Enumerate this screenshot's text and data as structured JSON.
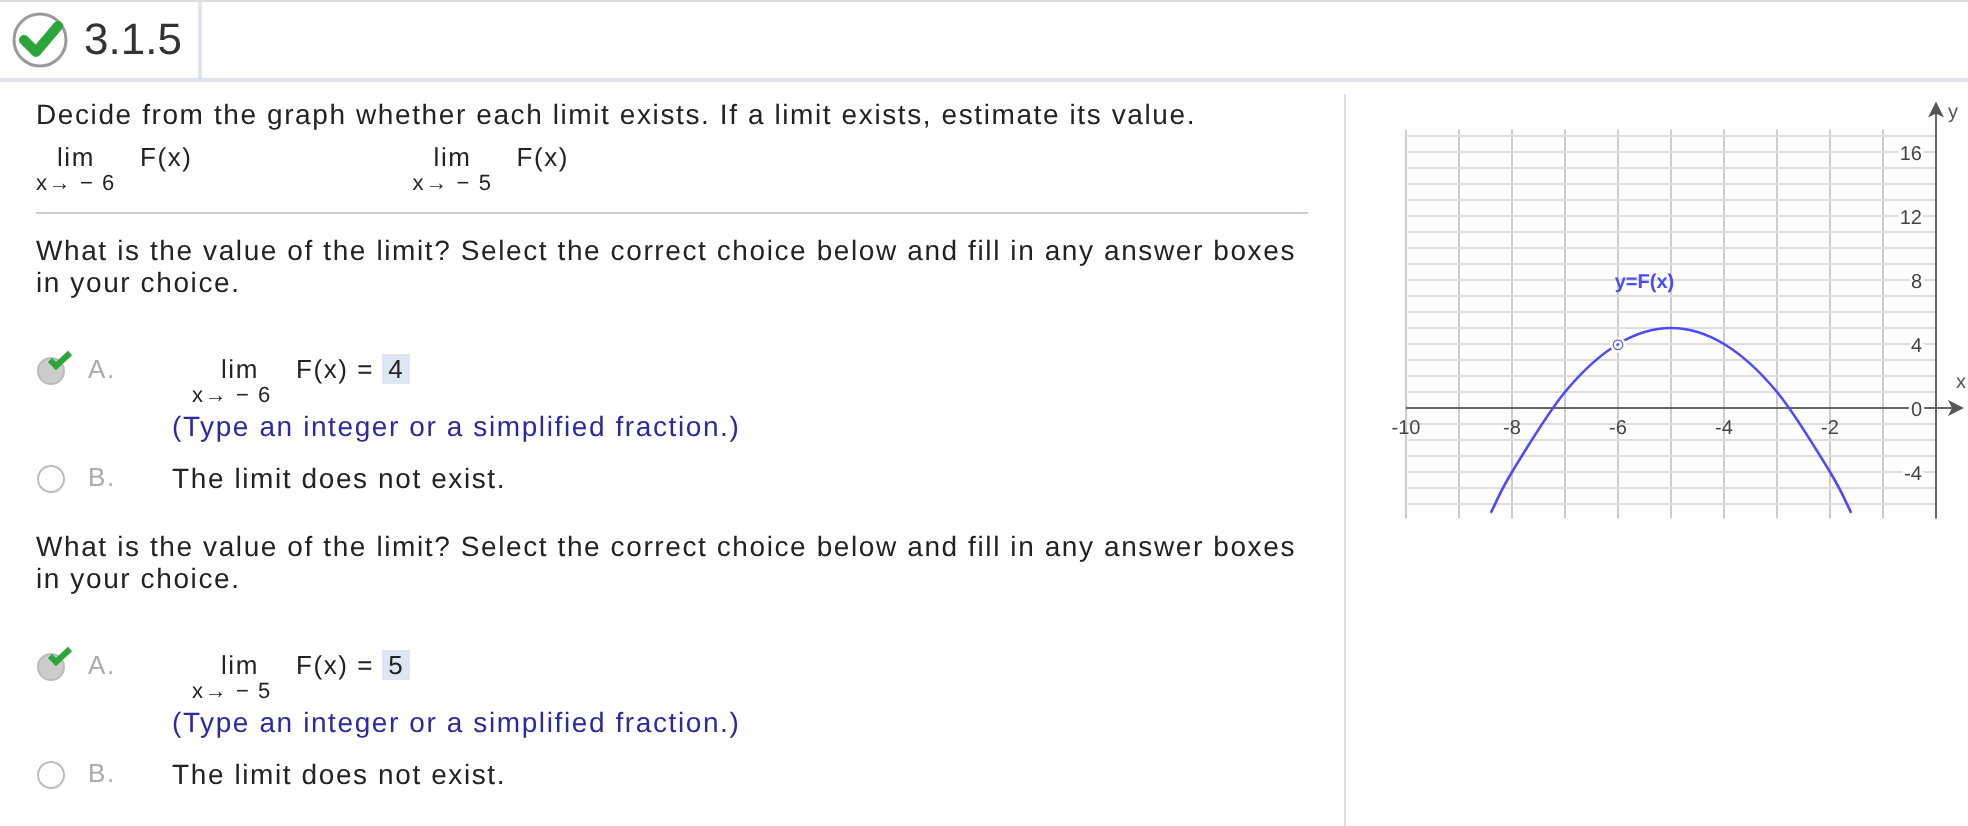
{
  "header": {
    "number": "3.1.5",
    "correct": true
  },
  "instructions": "Decide from the graph whether each limit exists. If a limit exists, estimate its value.",
  "limits": [
    {
      "lim": "lim",
      "func": "F(x)",
      "approach": "x→ − 6"
    },
    {
      "lim": "lim",
      "func": "F(x)",
      "approach": "x→ − 5"
    }
  ],
  "questions": [
    {
      "prompt": "What is the value of the limit? Select the correct choice below and fill in any answer boxes in your choice.",
      "choices": [
        {
          "letter": "A.",
          "kind": "limit",
          "selected": true,
          "lim": "lim",
          "func": "F(x) =",
          "answer": "4",
          "approach": "x→ − 6",
          "hint": "(Type an integer or a simplified fraction.)"
        },
        {
          "letter": "B.",
          "kind": "text",
          "selected": false,
          "text": "The limit does not exist."
        }
      ]
    },
    {
      "prompt": "What is the value of the limit? Select the correct choice below and fill in any answer boxes in your choice.",
      "choices": [
        {
          "letter": "A.",
          "kind": "limit",
          "selected": true,
          "lim": "lim",
          "func": "F(x) =",
          "answer": "5",
          "approach": "x→ − 5",
          "hint": "(Type an integer or a simplified fraction.)"
        },
        {
          "letter": "B.",
          "kind": "text",
          "selected": false,
          "text": "The limit does not exist."
        }
      ]
    }
  ],
  "graph": {
    "chart_data": {
      "type": "line",
      "xlabel": "x",
      "ylabel": "y",
      "xlim": [
        -10,
        0
      ],
      "ylim": [
        -6.9,
        17.4
      ],
      "xticks": [
        {
          "value": -10,
          "label": "-10"
        },
        {
          "value": -8,
          "label": "-8"
        },
        {
          "value": -6,
          "label": "-6"
        },
        {
          "value": -4,
          "label": "-4"
        },
        {
          "value": -2,
          "label": "-2"
        }
      ],
      "yticks": [
        {
          "value": -4,
          "label": "-4"
        },
        {
          "value": 0,
          "label": "0"
        },
        {
          "value": 4,
          "label": "4"
        },
        {
          "value": 8,
          "label": "8"
        },
        {
          "value": 12,
          "label": "12"
        },
        {
          "value": 16,
          "label": "16"
        }
      ],
      "x": [
        -8.4,
        -8,
        -7,
        -6,
        -5,
        -4,
        -3,
        -2,
        -1.6
      ],
      "series": [
        {
          "name": "y=F(x)",
          "color": "#4a4aff",
          "values": [
            -6.56,
            -4,
            1,
            4,
            5,
            4,
            1,
            -4,
            -6.56
          ]
        }
      ],
      "grid": true,
      "annotations": [
        {
          "text": "○",
          "x": -6,
          "y": 4
        }
      ]
    }
  }
}
